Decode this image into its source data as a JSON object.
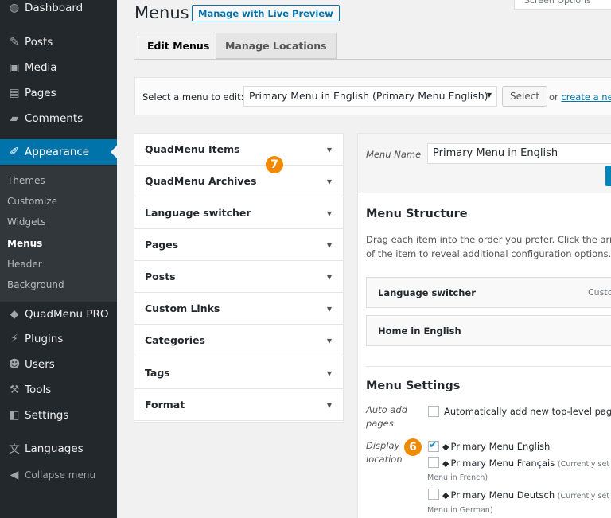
{
  "sidebar": {
    "items": [
      {
        "icon": "dashboard-icon",
        "glyph": "◍",
        "label": "Dashboard"
      },
      {
        "icon": "pin-icon",
        "glyph": "✎",
        "label": "Posts"
      },
      {
        "icon": "media-icon",
        "glyph": "▣",
        "label": "Media"
      },
      {
        "icon": "pages-icon",
        "glyph": "▤",
        "label": "Pages"
      },
      {
        "icon": "comments-icon",
        "glyph": "▰",
        "label": "Comments"
      },
      {
        "icon": "appearance-icon",
        "glyph": "✐",
        "label": "Appearance"
      },
      {
        "icon": "quadmenu-icon",
        "glyph": "◆",
        "label": "QuadMenu PRO"
      },
      {
        "icon": "plugins-icon",
        "glyph": "⚡",
        "label": "Plugins"
      },
      {
        "icon": "users-icon",
        "glyph": "☻",
        "label": "Users"
      },
      {
        "icon": "tools-icon",
        "glyph": "⚒",
        "label": "Tools"
      },
      {
        "icon": "settings-icon",
        "glyph": "◧",
        "label": "Settings"
      },
      {
        "icon": "languages-icon",
        "glyph": "文",
        "label": "Languages"
      },
      {
        "icon": "collapse-icon",
        "glyph": "◀",
        "label": "Collapse menu"
      }
    ],
    "submenu": [
      "Themes",
      "Customize",
      "Widgets",
      "Menus",
      "Header",
      "Background"
    ]
  },
  "header": {
    "title": "Menus",
    "live_preview": "Manage with Live Preview",
    "screen_options": "Screen Options"
  },
  "tabs": [
    "Edit Menus",
    "Manage Locations"
  ],
  "select_bar": {
    "label": "Select a menu to edit:",
    "selected": "Primary Menu in English (Primary Menu English)",
    "select_button": "Select",
    "or_text": "or",
    "create_link": "create a new"
  },
  "accordion": [
    "QuadMenu Items",
    "QuadMenu Archives",
    "Language switcher",
    "Pages",
    "Posts",
    "Custom Links",
    "Categories",
    "Tags",
    "Format"
  ],
  "badges": {
    "seven": "7",
    "six": "6"
  },
  "menu_panel": {
    "name_label": "Menu Name",
    "name_value": "Primary Menu in English",
    "structure_title": "Menu Structure",
    "help_line1": "Drag each item into the order you prefer. Click the arrow",
    "help_line2": "of the item to reveal additional configuration options.",
    "items": [
      {
        "label": "Language switcher",
        "type": "Custo"
      },
      {
        "label": "Home in English",
        "type": ""
      }
    ],
    "settings_title": "Menu Settings",
    "auto_add_label_1": "Auto add",
    "auto_add_label_2": "pages",
    "auto_add_text": "Automatically add new top-level pages",
    "display_label_1": "Display",
    "display_label_2": "location",
    "locations": [
      {
        "label": "Primary Menu English",
        "note": "",
        "sub": "",
        "checked": true
      },
      {
        "label": "Primary Menu Français",
        "note": "(Currently set t",
        "sub": "Menu in French)",
        "checked": false
      },
      {
        "label": "Primary Menu Deutsch",
        "note": "(Currently set t",
        "sub": "Menu in German)",
        "checked": false
      }
    ]
  }
}
